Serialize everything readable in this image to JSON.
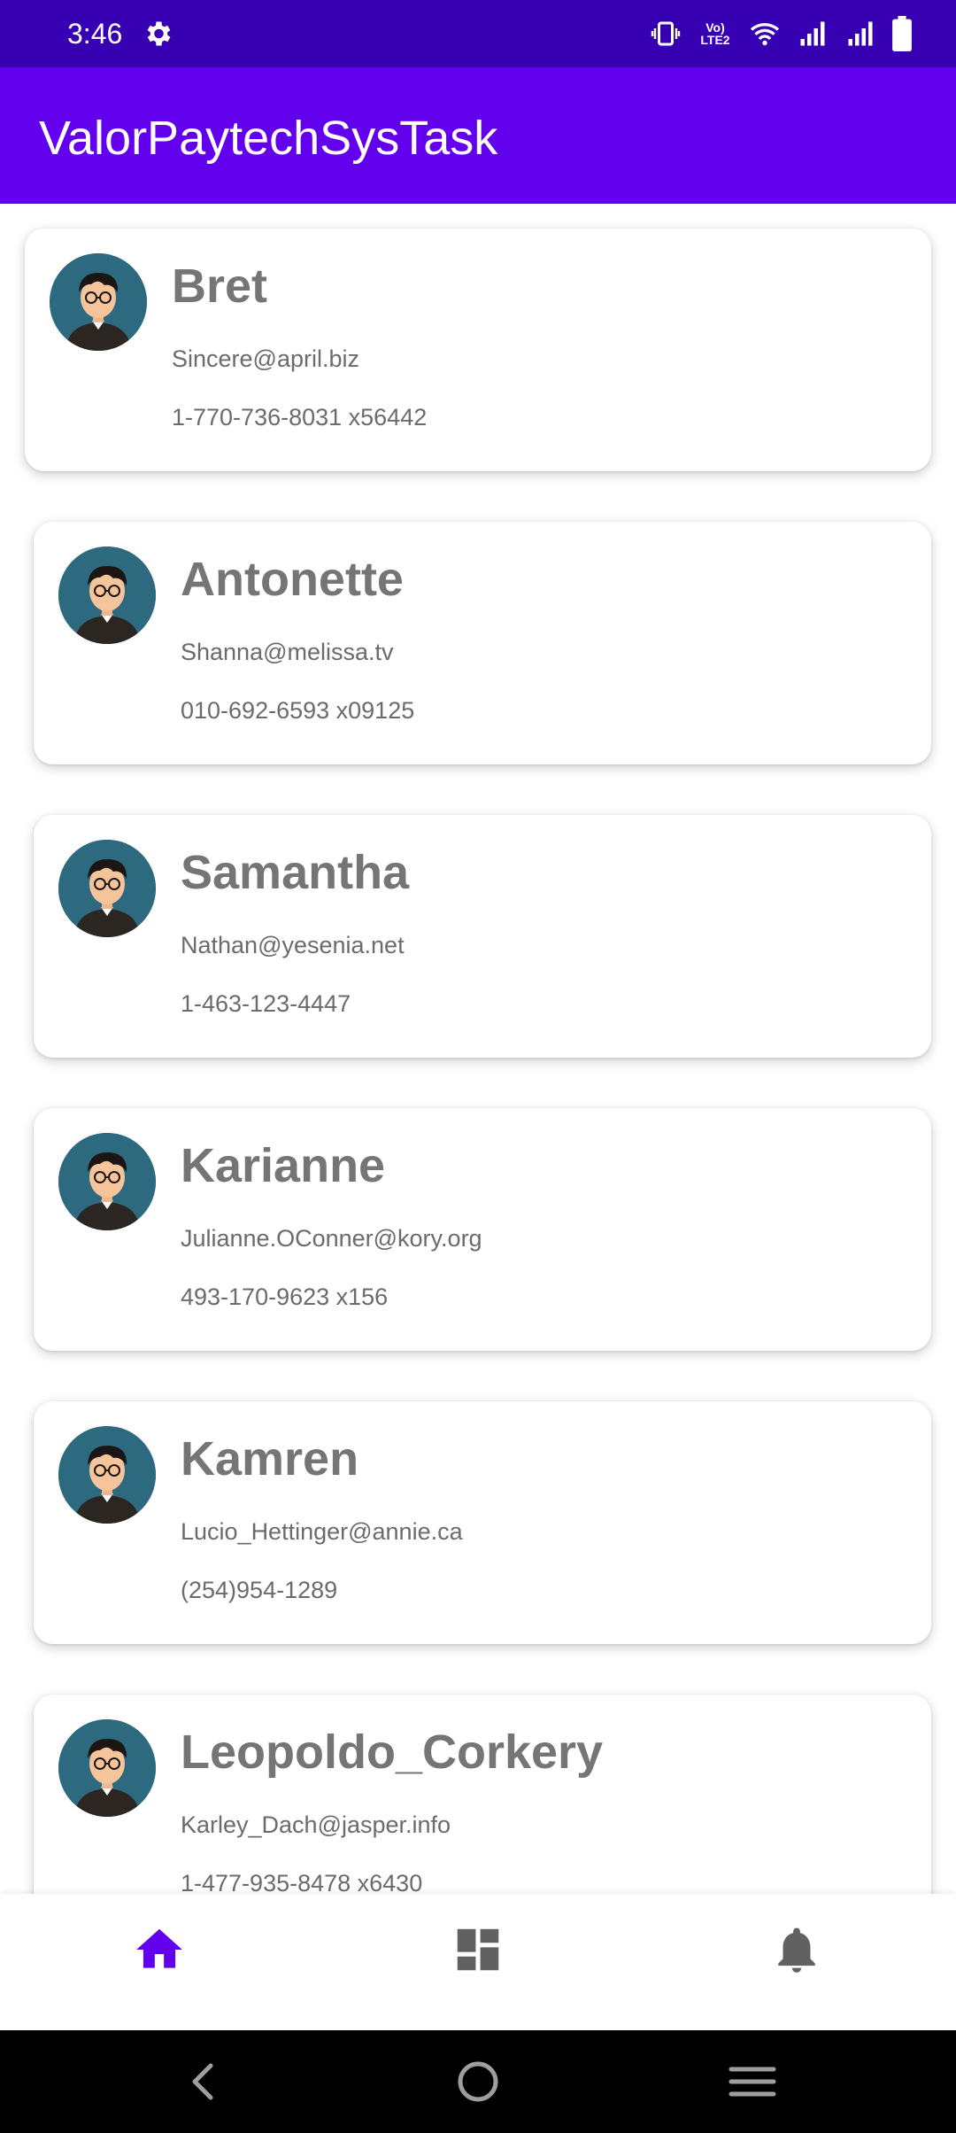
{
  "status_bar": {
    "time": "3:46",
    "volte_label": "Vo) LTE2",
    "icons": [
      "settings-gear-icon",
      "vibrate-icon",
      "volte-icon",
      "wifi-icon",
      "signal-icon",
      "signal-icon",
      "battery-icon"
    ]
  },
  "app_bar": {
    "title": "ValorPaytechSysTask"
  },
  "users": [
    {
      "name": "Bret",
      "email": "Sincere@april.biz",
      "phone": "1-770-736-8031 x56442"
    },
    {
      "name": "Antonette",
      "email": "Shanna@melissa.tv",
      "phone": "010-692-6593 x09125"
    },
    {
      "name": "Samantha",
      "email": "Nathan@yesenia.net",
      "phone": "1-463-123-4447"
    },
    {
      "name": "Karianne",
      "email": "Julianne.OConner@kory.org",
      "phone": "493-170-9623 x156"
    },
    {
      "name": "Kamren",
      "email": "Lucio_Hettinger@annie.ca",
      "phone": "(254)954-1289"
    },
    {
      "name": "Leopoldo_Corkery",
      "email": "Karley_Dach@jasper.info",
      "phone": "1-477-935-8478 x6430"
    }
  ],
  "bottom_nav": {
    "items": [
      {
        "icon": "home-icon",
        "selected": true
      },
      {
        "icon": "dashboard-icon",
        "selected": false
      },
      {
        "icon": "bell-icon",
        "selected": false
      }
    ]
  },
  "colors": {
    "status_bar": "#3700b3",
    "app_bar": "#6200ee",
    "accent": "#6200ee",
    "text_secondary": "#757575",
    "nav_inactive": "#616161"
  }
}
